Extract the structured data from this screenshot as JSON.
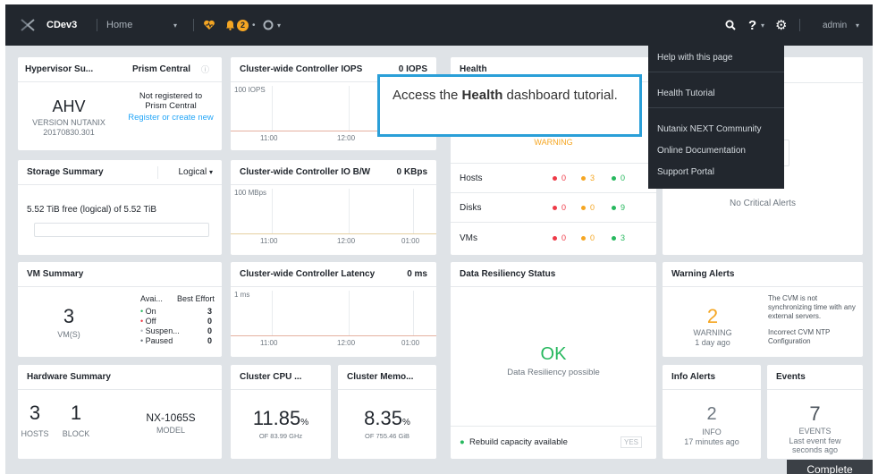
{
  "topbar": {
    "cluster_name": "CDev3",
    "nav_label": "Home",
    "alert_count": "2",
    "user": "admin"
  },
  "help_menu": {
    "items": [
      "Help with this page",
      "Health Tutorial",
      "Nutanix NEXT Community",
      "Online Documentation",
      "Support Portal"
    ]
  },
  "callout": {
    "prefix": "Access the ",
    "bold": "Health",
    "suffix": " dashboard tutorial."
  },
  "hypervisor": {
    "title": "Hypervisor Su...",
    "value": "AHV",
    "version_line1": "VERSION NUTANIX",
    "version_line2": "20170830.301"
  },
  "prism_central": {
    "title": "Prism Central",
    "status_line1": "Not registered to",
    "status_line2": "Prism Central",
    "link": "Register or create new"
  },
  "iops": {
    "title": "Cluster-wide Controller IOPS",
    "value": "0 IOPS",
    "scale": "100 IOPS",
    "ticks": [
      "11:00",
      "12:00"
    ]
  },
  "health": {
    "title": "Health",
    "status": "WARNING",
    "rows": [
      {
        "label": "Hosts",
        "red": "0",
        "orange": "3",
        "green": "0"
      },
      {
        "label": "Disks",
        "red": "0",
        "orange": "0",
        "green": "9"
      },
      {
        "label": "VMs",
        "red": "0",
        "orange": "0",
        "green": "3"
      }
    ]
  },
  "critical_alerts": {
    "message": "No Critical Alerts"
  },
  "storage": {
    "title": "Storage Summary",
    "mode": "Logical",
    "free_text": "5.52 TiB free (logical) of 5.52 TiB",
    "used_fraction": 0
  },
  "io_bw": {
    "title": "Cluster-wide Controller IO B/W",
    "value": "0 KBps",
    "scale": "100 MBps",
    "ticks": [
      "11:00",
      "12:00",
      "01:00"
    ]
  },
  "vm_summary": {
    "title": "VM Summary",
    "count": "3",
    "count_label": "VM(S)",
    "col1": "Avai...",
    "col2": "Best Effort",
    "states": [
      {
        "label": "On",
        "value": "3",
        "color": "#27b85e"
      },
      {
        "label": "Off",
        "value": "0",
        "color": "#ee3a47"
      },
      {
        "label": "Suspen...",
        "value": "0",
        "color": "#b3b9bf"
      },
      {
        "label": "Paused",
        "value": "0",
        "color": "#6e7780"
      }
    ]
  },
  "latency": {
    "title": "Cluster-wide Controller Latency",
    "value": "0 ms",
    "scale": "1 ms",
    "ticks": [
      "11:00",
      "12:00",
      "01:00"
    ]
  },
  "resiliency": {
    "title": "Data Resiliency Status",
    "status": "OK",
    "subtitle": "Data Resiliency possible",
    "rebuild": "Rebuild capacity available",
    "rebuild_value": "YES"
  },
  "warning_alerts": {
    "title": "Warning Alerts",
    "count": "2",
    "label": "WARNING",
    "time": "1 day ago",
    "alert1": "The CVM is not synchronizing time with any external servers.",
    "alert2": "Incorrect CVM NTP Configuration"
  },
  "hardware": {
    "title": "Hardware Summary",
    "hosts": "3",
    "hosts_label": "HOSTS",
    "blocks": "1",
    "blocks_label": "BLOCK",
    "model": "NX-1065S",
    "model_label": "MODEL"
  },
  "cpu": {
    "title": "Cluster CPU ...",
    "value": "11.85",
    "unit": "%",
    "of": "OF 83.99 GHz"
  },
  "memory": {
    "title": "Cluster Memo...",
    "value": "8.35",
    "unit": "%",
    "of": "OF 755.46 GiB"
  },
  "info_alerts": {
    "title": "Info Alerts",
    "count": "2",
    "label": "INFO",
    "time": "17 minutes ago"
  },
  "events": {
    "title": "Events",
    "count": "7",
    "label": "EVENTS",
    "time1": "Last event few",
    "time2": "seconds ago"
  },
  "complete_button": "Complete",
  "colors": {
    "topbar": "#22272e",
    "ok": "#27b85e",
    "warning": "#f5a623",
    "critical": "#ee3a47",
    "link": "#22a5f7",
    "callout_border": "#2a9fd8"
  }
}
